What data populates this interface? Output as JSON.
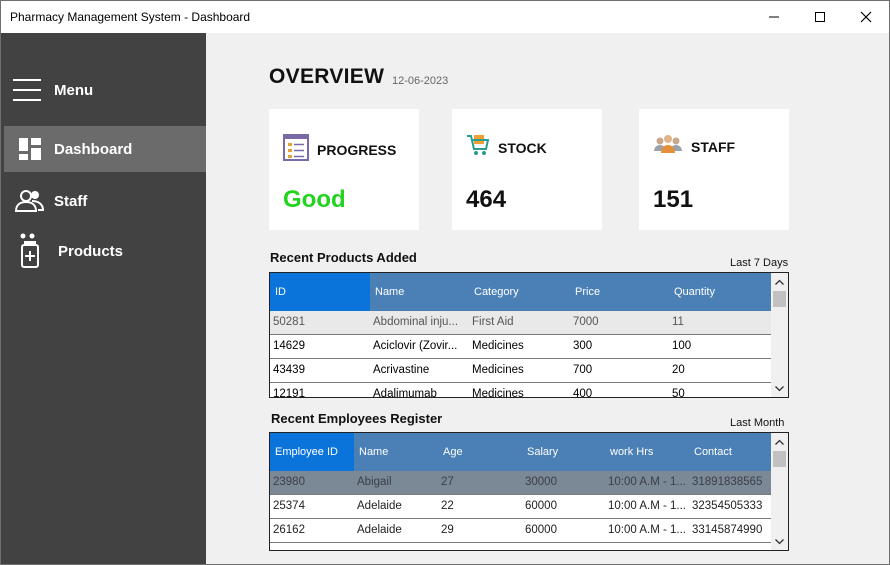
{
  "window": {
    "title": "Pharmacy Management System - Dashboard"
  },
  "sidebar": {
    "menu_label": "Menu",
    "items": [
      {
        "label": "Dashboard",
        "icon": "dashboard-icon",
        "active": true
      },
      {
        "label": "Staff",
        "icon": "staff-icon",
        "active": false
      },
      {
        "label": "Products",
        "icon": "products-icon",
        "active": false
      }
    ]
  },
  "overview": {
    "title": "OVERVIEW",
    "date": "12-06-2023"
  },
  "cards": [
    {
      "title": "PROGRESS",
      "value": "Good",
      "icon": "progress-checklist-icon",
      "value_color": "#22d31f"
    },
    {
      "title": "STOCK",
      "value": "464",
      "icon": "shopping-cart-icon"
    },
    {
      "title": "STAFF",
      "value": "151",
      "icon": "people-group-icon"
    }
  ],
  "products": {
    "title": "Recent Products Added",
    "range": "Last 7 Days",
    "columns": [
      "ID",
      "Name",
      "Category",
      "Price",
      "Quantity"
    ],
    "rows": [
      [
        "50281",
        "Abdominal inju...",
        "First Aid",
        "7000",
        "11"
      ],
      [
        "14629",
        "Aciclovir (Zovir...",
        "Medicines",
        "300",
        "100"
      ],
      [
        "43439",
        "Acrivastine",
        "Medicines",
        "700",
        "20"
      ],
      [
        "12191",
        "Adalimumab",
        "Medicines",
        "400",
        "50"
      ]
    ]
  },
  "employees": {
    "title": "Recent Employees Register",
    "range": "Last Month",
    "columns": [
      "Employee ID",
      "Name",
      "Age",
      "Salary",
      "work Hrs",
      "Contact"
    ],
    "rows": [
      [
        "23980",
        "Abigail",
        "27",
        "30000",
        "10:00 A.M - 1...",
        "31891838565"
      ],
      [
        "25374",
        "Adelaide",
        "22",
        "60000",
        "10:00 A.M - 1...",
        "32354505333"
      ],
      [
        "26162",
        "Adelaide",
        "29",
        "60000",
        "10:00 A.M - 1...",
        "33145874990"
      ]
    ]
  },
  "colors": {
    "sidebar": "#424242",
    "sidebar_active": "#6b6b6b",
    "grid_header": "#4a80b5",
    "grid_header_selected": "#0a74da",
    "progress_good": "#22d31f"
  }
}
